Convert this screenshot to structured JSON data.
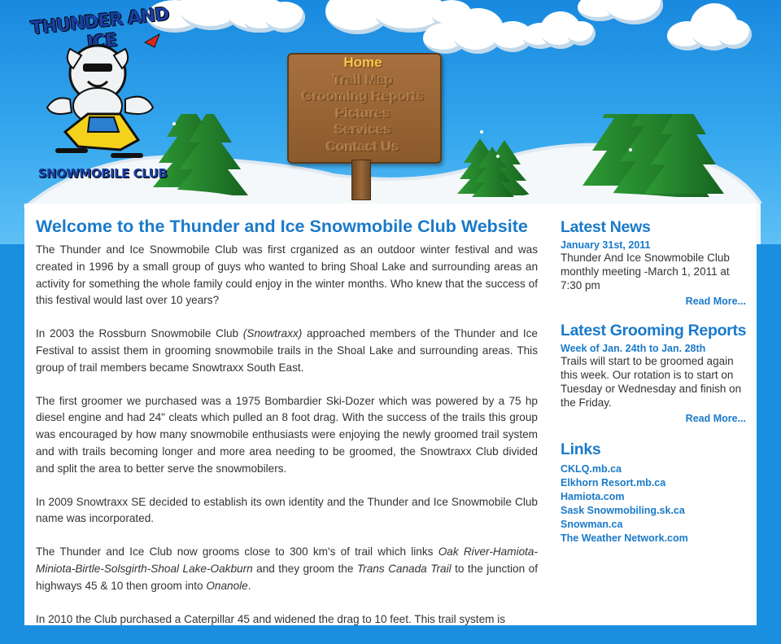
{
  "logo": {
    "title": "THUNDER AND ICE",
    "subtitle": "SNOWMOBILE CLUB"
  },
  "nav": {
    "items": [
      {
        "label": "Home",
        "active": true
      },
      {
        "label": "Trail Map"
      },
      {
        "label": "Grooming Reports"
      },
      {
        "label": "Pictures"
      },
      {
        "label": "Services"
      },
      {
        "label": "Contact Us"
      }
    ]
  },
  "main": {
    "title": "Welcome to the Thunder and Ice Snowmobile Club Website",
    "p1": "The Thunder and Ice Snowmobile Club was first crganized as an outdoor winter festival and was created in 1996 by a small group of guys who wanted to bring Shoal Lake and surrounding areas an activity for something the whole family could enjoy in the winter months. Who knew that the success of this festival would last over 10 years?",
    "p2_a": "In 2003 the Rossburn Snowmobile Club ",
    "p2_em": "(Snowtraxx)",
    "p2_b": " approached members of the Thunder and Ice Festival to assist them in grooming snowmobile trails in the Shoal Lake and surrounding areas. This group of trail members became Snowtraxx South East.",
    "p3": "The first groomer we purchased was a 1975 Bombardier Ski-Dozer which was powered by a 75 hp diesel engine and had 24\" cleats which pulled an 8 foot drag. With the success of the trails this group was encouraged by how many snowmobile enthusiasts were enjoying the newly groomed trail system and with trails becoming longer and more area needing to be groomed, the Snowtraxx Club divided and split the area to better serve the snowmobilers.",
    "p4": "In 2009 Snowtraxx SE decided to establish its own identity and the Thunder and Ice Snowmobile Club name was incorporated.",
    "p5_a": "The Thunder and Ice Club now grooms close to 300 km's of trail which links ",
    "p5_em1": "Oak River-Hamiota-Miniota-Birtle-Solsgirth-Shoal Lake-Oakburn",
    "p5_b": " and they groom the ",
    "p5_em2": "Trans Canada Trail",
    "p5_c": " to the junction of highways 45 & 10 then groom into ",
    "p5_em3": "Onanole",
    "p5_d": ".",
    "p6": "In 2010 the Club purchased a Caterpillar 45 and widened the drag to 10 feet. This trail system is"
  },
  "sidebar": {
    "news": {
      "heading": "Latest News",
      "date": "January 31st, 2011",
      "body": "Thunder And Ice Snowmobile Club monthly meeting -March 1, 2011 at 7:30 pm",
      "more": "Read More..."
    },
    "grooming": {
      "heading": "Latest Grooming Reports",
      "date": "Week of Jan. 24th to Jan. 28th",
      "body": "Trails will start to be groomed again this week. Our rotation is to start on Tuesday or Wednesday and finish on the Friday.",
      "more": "Read More..."
    },
    "links": {
      "heading": "Links",
      "items": [
        "CKLQ.mb.ca",
        "Elkhorn Resort.mb.ca",
        "Hamiota.com",
        "Sask Snowmobiling.sk.ca",
        "Snowman.ca",
        "The Weather Network.com"
      ]
    }
  },
  "colors": {
    "accent": "#1a7ac9",
    "sky": "#1a8fe0",
    "tree": "#1f7a2a",
    "wood": "#9b6a3a",
    "nav_active": "#f6c64a"
  }
}
